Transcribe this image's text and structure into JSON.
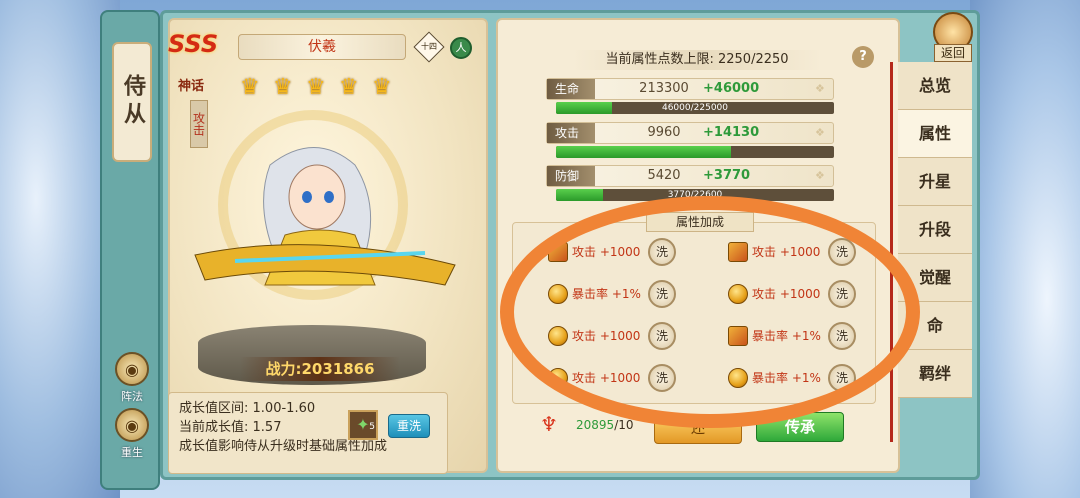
{
  "sidebar": {
    "title": "侍从",
    "buttons": [
      {
        "label": "阵法",
        "icon": "formation-icon"
      },
      {
        "label": "重生",
        "icon": "rebirth-icon"
      }
    ]
  },
  "hero": {
    "rank": "SSS",
    "tier": "神话",
    "role": "攻击",
    "name": "伏羲",
    "level_badge": "十四",
    "race_badge": "人",
    "stars": 5,
    "power_label": "战力:",
    "power_value": "2031866"
  },
  "growth": {
    "range_label": "成长值区间:",
    "range_value": "1.00-1.60",
    "current_label": "当前成长值:",
    "current_value": "1.57",
    "note": "成长值影响侍从升级时基础属性加成",
    "item_count": "5",
    "reroll_label": "重洗"
  },
  "stats": {
    "cap_label": "当前属性点数上限:",
    "cap_value": "2250/2250",
    "rows": [
      {
        "name": "生命",
        "base": "213300",
        "bonus": "+46000",
        "bar_text": "46000/225000",
        "fill": 0.2
      },
      {
        "name": "攻击",
        "base": "9960",
        "bonus": "+14130",
        "bar_text": "",
        "fill": 0.63
      },
      {
        "name": "防御",
        "base": "5420",
        "bonus": "+3770",
        "bar_text": "3770/22600",
        "fill": 0.17
      }
    ]
  },
  "bonus": {
    "title": "属性加成",
    "wash_label": "洗",
    "left": [
      {
        "text": "攻击 +1000",
        "gem": "square"
      },
      {
        "text": "暴击率 +1%",
        "gem": "round"
      },
      {
        "text": "攻击 +1000",
        "gem": "round"
      },
      {
        "text": "攻击 +1000",
        "gem": "round"
      }
    ],
    "right": [
      {
        "text": "攻击 +1000",
        "gem": "square"
      },
      {
        "text": "攻击 +1000",
        "gem": "round"
      },
      {
        "text": "暴击率 +1%",
        "gem": "square"
      },
      {
        "text": "暴击率 +1%",
        "gem": "round"
      }
    ]
  },
  "footer": {
    "count": "20895",
    "count_suffix": "/10",
    "left_button": "还",
    "right_button": "传承"
  },
  "tabs": [
    "总览",
    "属性",
    "升星",
    "升段",
    "觉醒",
    "命",
    "羁绊"
  ],
  "active_tab": "属性",
  "back_label": "返回",
  "colors": {
    "accent": "#f08436",
    "bonus_green": "#2e9a3a",
    "red_text": "#c23516"
  }
}
